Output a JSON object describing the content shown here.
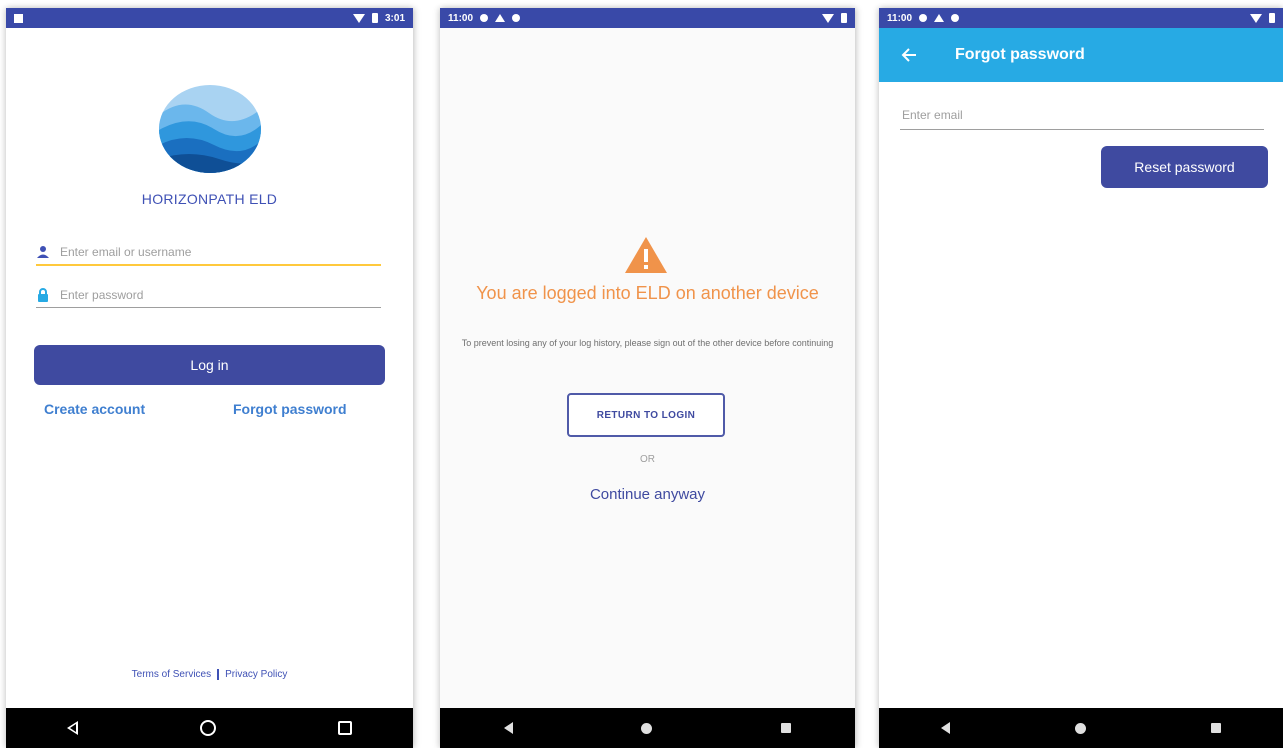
{
  "screens": {
    "login": {
      "status": {
        "time": "3:01"
      },
      "app_name": "HORIZONPATH ELD",
      "email_placeholder": "Enter email or username",
      "password_placeholder": "Enter password",
      "login_label": "Log in",
      "create_account": "Create account",
      "forgot_password": "Forgot password",
      "terms": "Terms of Services",
      "privacy": "Privacy Policy"
    },
    "logged_elsewhere": {
      "status": {
        "time": "11:00"
      },
      "title": "You are logged into ELD on another device",
      "subtitle": "To prevent losing any of your log history, please sign out of the other device before continuing",
      "return_label": "RETURN TO LOGIN",
      "or_label": "OR",
      "continue_label": "Continue anyway"
    },
    "forgot": {
      "status": {
        "time": "11:00"
      },
      "title": "Forgot password",
      "email_placeholder": "Enter email",
      "reset_label": "Reset password"
    }
  },
  "colors": {
    "status_bar": "#3949a8",
    "primary": "#3f4aa0",
    "app_bar": "#27aae4",
    "warning": "#f0934a",
    "link": "#3f7fd0",
    "focus_underline": "#ffc93c"
  },
  "icons": [
    "user-icon",
    "lock-icon",
    "warning-icon",
    "back-arrow-icon",
    "nav-back-icon",
    "nav-home-icon",
    "nav-recents-icon"
  ]
}
